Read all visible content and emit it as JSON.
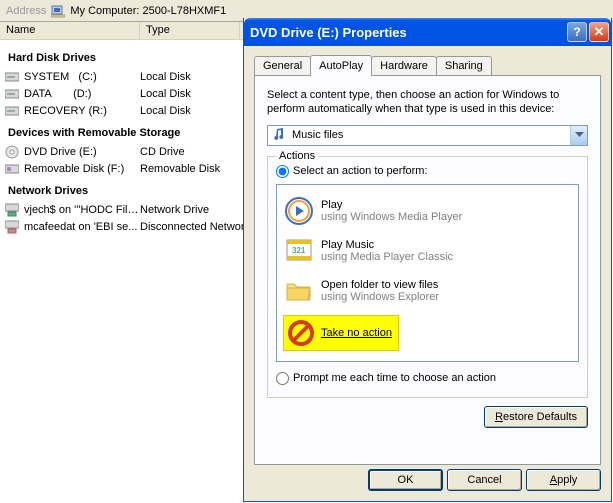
{
  "address": {
    "label": "Address",
    "text": "My Computer: 2500-L78HXMF1"
  },
  "columns": {
    "name": "Name",
    "type": "Type"
  },
  "sections": {
    "hdd": "Hard Disk Drives",
    "removable": "Devices with Removable Storage",
    "network": "Network Drives"
  },
  "drives": {
    "hdd": [
      {
        "name": "SYSTEM",
        "letter": "(C:)",
        "type": "Local Disk"
      },
      {
        "name": "DATA",
        "letter": "(D:)",
        "type": "Local Disk"
      },
      {
        "name": "RECOVERY",
        "letter": "(R:)",
        "type": "Local Disk"
      }
    ],
    "removable": [
      {
        "name": "DVD Drive (E:)",
        "type": "CD Drive"
      },
      {
        "name": "Removable Disk (F:)",
        "type": "Removable Disk"
      }
    ],
    "network": [
      {
        "name": "vjech$ on '''HODC File...",
        "type": "Network Drive"
      },
      {
        "name": "mcafeedat on 'EBI se...",
        "type": "Disconnected Network"
      }
    ]
  },
  "dialog": {
    "title": "DVD Drive (E:) Properties",
    "tabs": [
      "General",
      "AutoPlay",
      "Hardware",
      "Sharing"
    ],
    "activeTab": "AutoPlay",
    "instruction": "Select a content type, then choose an action for Windows to perform automatically when that type is used in this device:",
    "combo": "Music files",
    "actions_legend": "Actions",
    "radio_select": "Select an action to perform:",
    "radio_prompt": "Prompt me each time to choose an action",
    "action_items": [
      {
        "title": "Play",
        "sub": "using Windows Media Player",
        "icon": "wmp"
      },
      {
        "title": "Play Music",
        "sub": "using Media Player Classic",
        "icon": "mpc"
      },
      {
        "title": "Open folder to view files",
        "sub": "using Windows Explorer",
        "icon": "folder"
      },
      {
        "title": "Take no action",
        "sub": "",
        "icon": "no"
      }
    ],
    "buttons": {
      "restore": "Restore Defaults",
      "ok": "OK",
      "cancel": "Cancel",
      "apply": "Apply"
    }
  }
}
